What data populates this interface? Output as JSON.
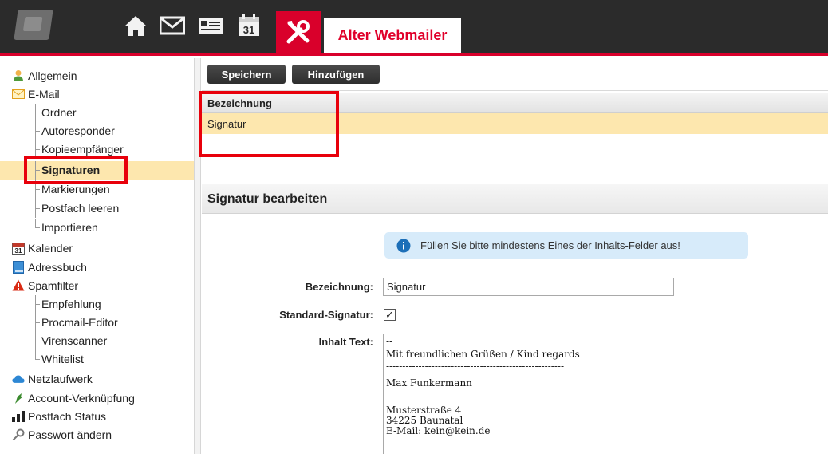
{
  "topbar": {
    "icons": [
      "logo",
      "home-icon",
      "mail-icon",
      "contacts-icon",
      "calendar-icon",
      "tools-icon"
    ],
    "calendar_day": "31",
    "active_tab_label": "Alter Webmailer",
    "accent_color": "#d9002b"
  },
  "sidebar": {
    "items": [
      {
        "label": "Allgemein",
        "icon": "user-icon"
      },
      {
        "label": "E-Mail",
        "icon": "mail-icon"
      },
      {
        "label": "Ordner"
      },
      {
        "label": "Autoresponder"
      },
      {
        "label": "Kopieempfänger"
      },
      {
        "label": "Signaturen",
        "active": true
      },
      {
        "label": "Markierungen"
      },
      {
        "label": "Postfach leeren"
      },
      {
        "label": "Importieren"
      },
      {
        "label": "Kalender",
        "icon": "calendar-icon"
      },
      {
        "label": "Adressbuch",
        "icon": "addressbook-icon"
      },
      {
        "label": "Spamfilter",
        "icon": "warning-icon"
      },
      {
        "label": "Empfehlung"
      },
      {
        "label": "Procmail-Editor"
      },
      {
        "label": "Virenscanner"
      },
      {
        "label": "Whitelist"
      },
      {
        "label": "Netzlaufwerk",
        "icon": "cloud-icon"
      },
      {
        "label": "Account-Verknüpfung",
        "icon": "link-icon"
      },
      {
        "label": "Postfach Status",
        "icon": "bar-chart-icon"
      },
      {
        "label": "Passwort ändern",
        "icon": "key-icon"
      }
    ],
    "calendar_day": "31"
  },
  "toolbar": {
    "save_label": "Speichern",
    "add_label": "Hinzufügen"
  },
  "list": {
    "column_header": "Bezeichnung",
    "rows": [
      "Signatur"
    ]
  },
  "edit": {
    "title": "Signatur bearbeiten",
    "info_text": "Füllen Sie bitte mindestens Eines der Inhalts-Felder aus!",
    "label_name": "Bezeichnung:",
    "name_value": "Signatur",
    "label_default": "Standard-Signatur:",
    "default_checked": true,
    "checkmark": "✓",
    "label_content": "Inhalt Text:",
    "content_lines": [
      "--",
      "Mit freundlichen Grüßen / Kind regards",
      "-------------------------------------------------------",
      "Max Funkermann",
      "",
      "Musterstraße 4",
      "34225 Baunatal",
      "E-Mail: kein@kein.de"
    ]
  }
}
